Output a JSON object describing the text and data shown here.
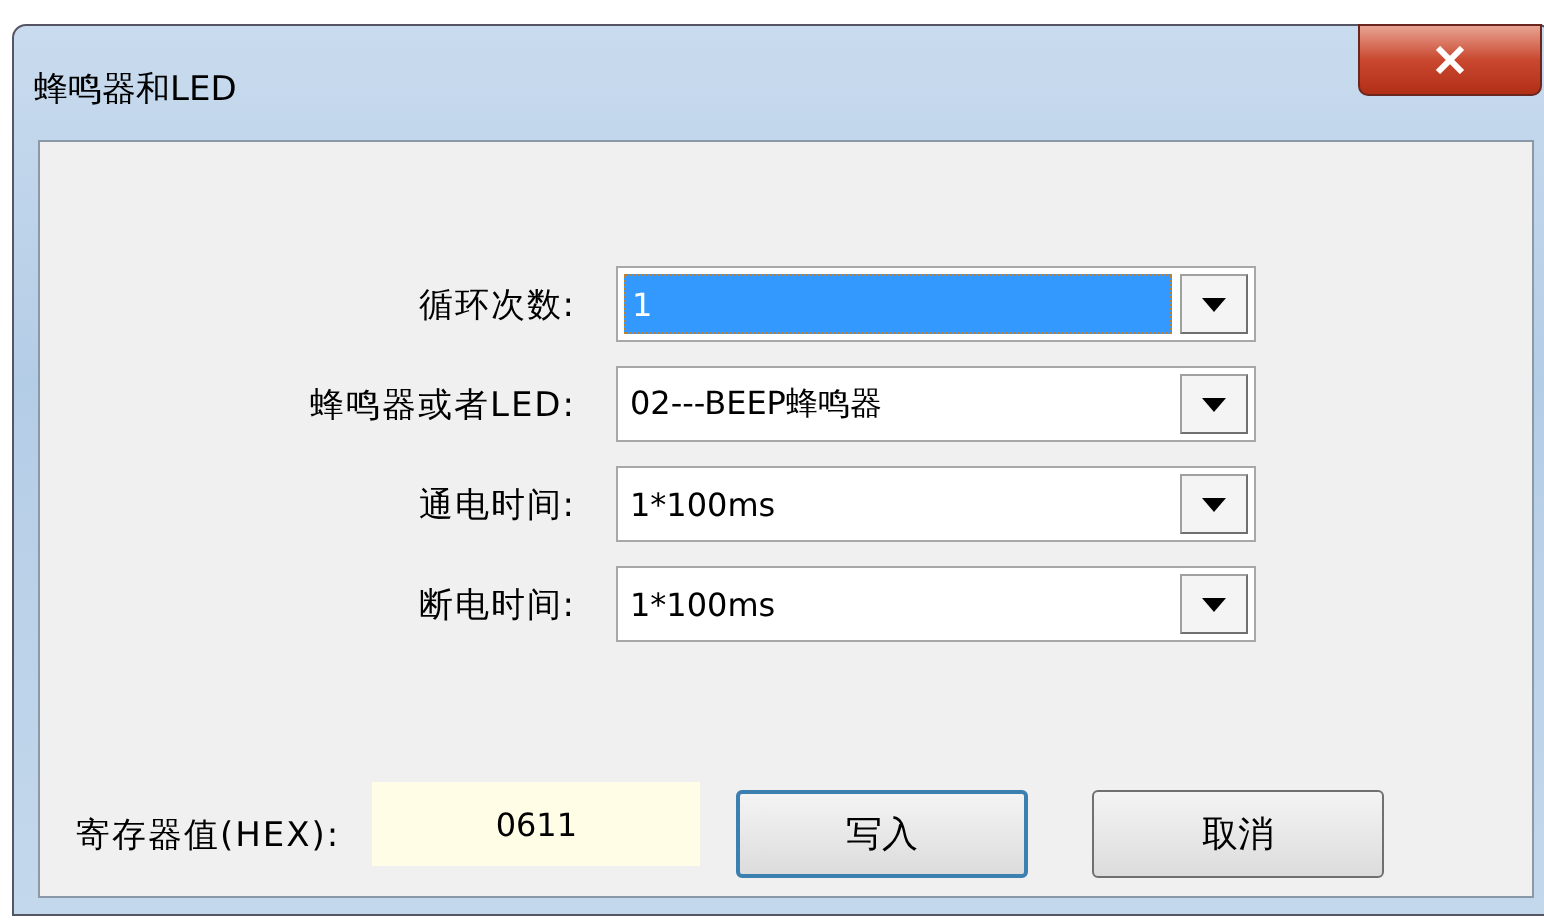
{
  "window": {
    "title": "蜂鸣器和LED"
  },
  "fields": [
    {
      "label": "循环次数:",
      "value": "1",
      "focused": true
    },
    {
      "label": "蜂鸣器或者LED:",
      "value": "02---BEEP蜂鸣器",
      "focused": false
    },
    {
      "label": "通电时间:",
      "value": "1*100ms",
      "focused": false
    },
    {
      "label": "断电时间:",
      "value": "1*100ms",
      "focused": false
    }
  ],
  "register": {
    "label": "寄存器值(HEX):",
    "value": "0611"
  },
  "buttons": [
    {
      "label": "写入",
      "default": true
    },
    {
      "label": "取消",
      "default": false
    }
  ]
}
